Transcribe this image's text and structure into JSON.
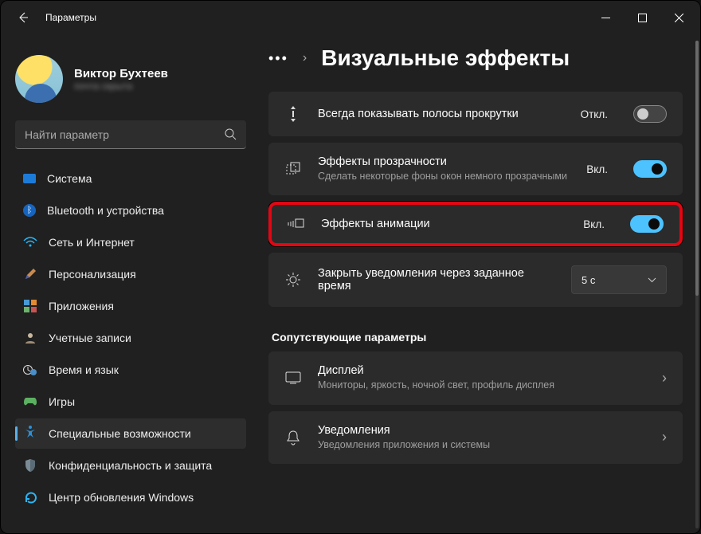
{
  "window": {
    "title": "Параметры"
  },
  "account": {
    "name": "Виктор Бухтеев",
    "email": "почта скрыта"
  },
  "search": {
    "placeholder": "Найти параметр"
  },
  "nav": {
    "system": "Система",
    "bluetooth": "Bluetooth и устройства",
    "network": "Сеть и Интернет",
    "personalization": "Персонализация",
    "apps": "Приложения",
    "accounts": "Учетные записи",
    "time": "Время и язык",
    "gaming": "Игры",
    "accessibility": "Специальные возможности",
    "privacy": "Конфиденциальность и защита",
    "update": "Центр обновления Windows"
  },
  "page": {
    "title": "Визуальные эффекты"
  },
  "cards": {
    "scrollbars": {
      "title": "Всегда показывать полосы прокрутки",
      "state": "Откл."
    },
    "transparency": {
      "title": "Эффекты прозрачности",
      "sub": "Сделать некоторые фоны окон немного прозрачными",
      "state": "Вкл."
    },
    "animation": {
      "title": "Эффекты анимации",
      "state": "Вкл."
    },
    "notifications_timeout": {
      "title": "Закрыть уведомления через заданное время",
      "value": "5 с"
    }
  },
  "related": {
    "heading": "Сопутствующие параметры",
    "display": {
      "title": "Дисплей",
      "sub": "Мониторы, яркость, ночной свет, профиль дисплея"
    },
    "notifications": {
      "title": "Уведомления",
      "sub": "Уведомления приложения и системы"
    }
  }
}
